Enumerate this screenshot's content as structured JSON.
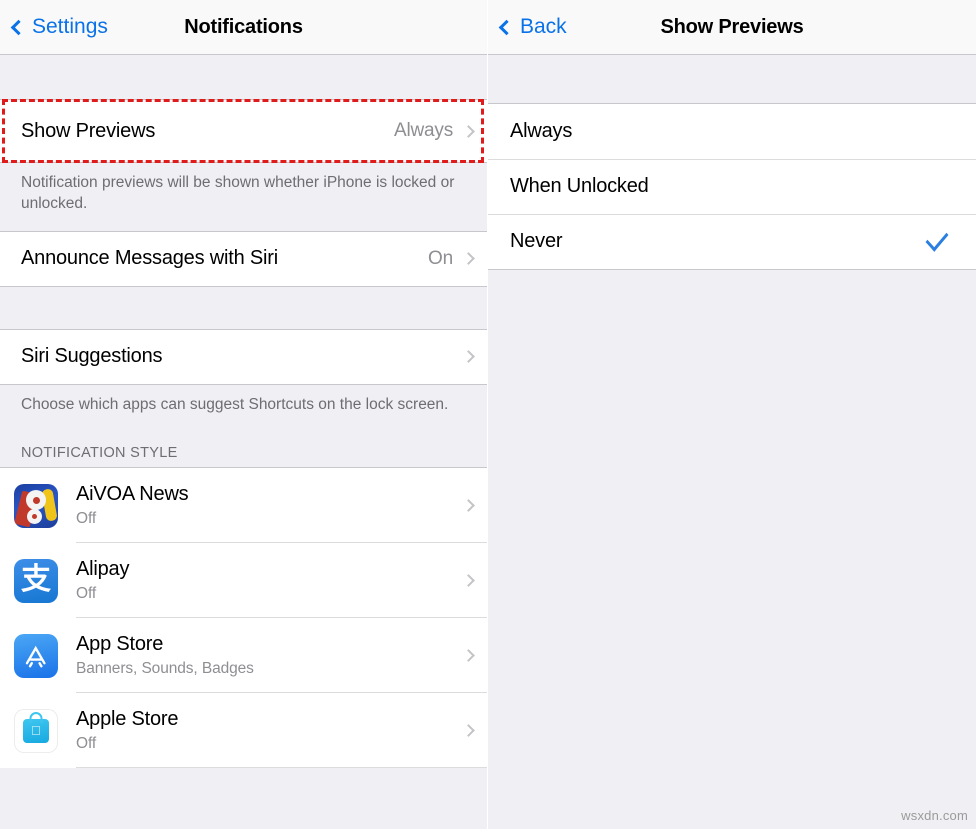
{
  "left_screen": {
    "nav": {
      "back_label": "Settings",
      "back_icon": "chevron-left-icon",
      "title": "Notifications"
    },
    "show_previews_row": {
      "label": "Show Previews",
      "value": "Always",
      "chevron_icon": "chevron-right-icon",
      "highlighted": true
    },
    "show_previews_footnote": "Notification previews will be shown whether iPhone is locked or unlocked.",
    "announce_row": {
      "label": "Announce Messages with Siri",
      "value": "On",
      "chevron_icon": "chevron-right-icon"
    },
    "siri_suggestions_row": {
      "label": "Siri Suggestions",
      "value": "",
      "chevron_icon": "chevron-right-icon"
    },
    "siri_suggestions_footnote": "Choose which apps can suggest Shortcuts on the lock screen.",
    "notification_style_header": "NOTIFICATION STYLE",
    "apps": [
      {
        "name": "AiVOA News",
        "status": "Off",
        "icon": "aivoa-news-app-icon",
        "chevron_icon": "chevron-right-icon"
      },
      {
        "name": "Alipay",
        "status": "Off",
        "icon": "alipay-app-icon",
        "chevron_icon": "chevron-right-icon"
      },
      {
        "name": "App Store",
        "status": "Banners, Sounds, Badges",
        "icon": "app-store-app-icon",
        "chevron_icon": "chevron-right-icon"
      },
      {
        "name": "Apple Store",
        "status": "Off",
        "icon": "apple-store-app-icon",
        "chevron_icon": "chevron-right-icon"
      }
    ]
  },
  "right_screen": {
    "nav": {
      "back_label": "Back",
      "back_icon": "chevron-left-icon",
      "title": "Show Previews"
    },
    "options": [
      {
        "label": "Always",
        "selected": false,
        "highlighted": false
      },
      {
        "label": "When Unlocked",
        "selected": false,
        "highlighted": false
      },
      {
        "label": "Never",
        "selected": true,
        "highlighted": true
      }
    ],
    "checkmark_icon": "checkmark-icon"
  },
  "watermark": "wsxdn.com",
  "colors": {
    "ios_blue": "#0a72e8",
    "checkmark_blue": "#2a7fe0",
    "highlight_red": "#e01b1b",
    "group_background": "#efeff4",
    "row_background": "#ffffff",
    "secondary_text": "#8e8e93"
  },
  "glyphs": {
    "alipay_char": "支",
    "apple_char": ""
  }
}
